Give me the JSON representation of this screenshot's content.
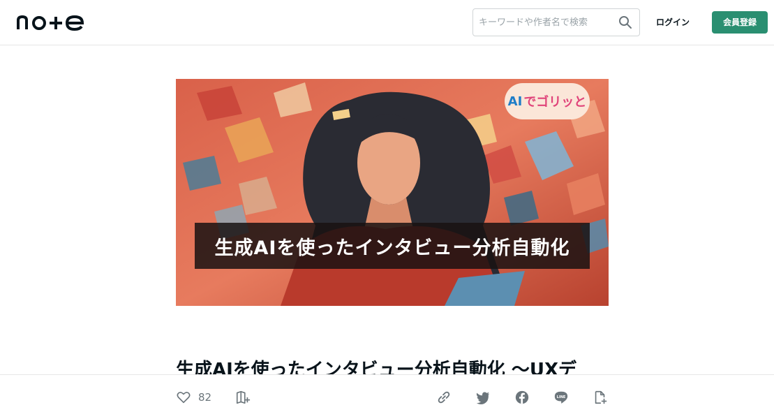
{
  "header": {
    "logo_text": "note",
    "search": {
      "placeholder": "キーワードや作者名で検索"
    },
    "login_label": "ログイン",
    "signup_label": "会員登録",
    "accent_color": "#2a8f71"
  },
  "hero": {
    "banner_text": "生成AIを使ったインタビュー分析自動化",
    "badge_ai": "AI",
    "badge_rest": "でゴリッと"
  },
  "article": {
    "title": "生成AIを使ったインタビュー分析自動化 〜UXデ"
  },
  "actions": {
    "like_count": "82",
    "icons": [
      "heart-icon",
      "magazine-add-icon",
      "link-icon",
      "twitter-icon",
      "facebook-icon",
      "line-icon",
      "embed-icon"
    ]
  }
}
